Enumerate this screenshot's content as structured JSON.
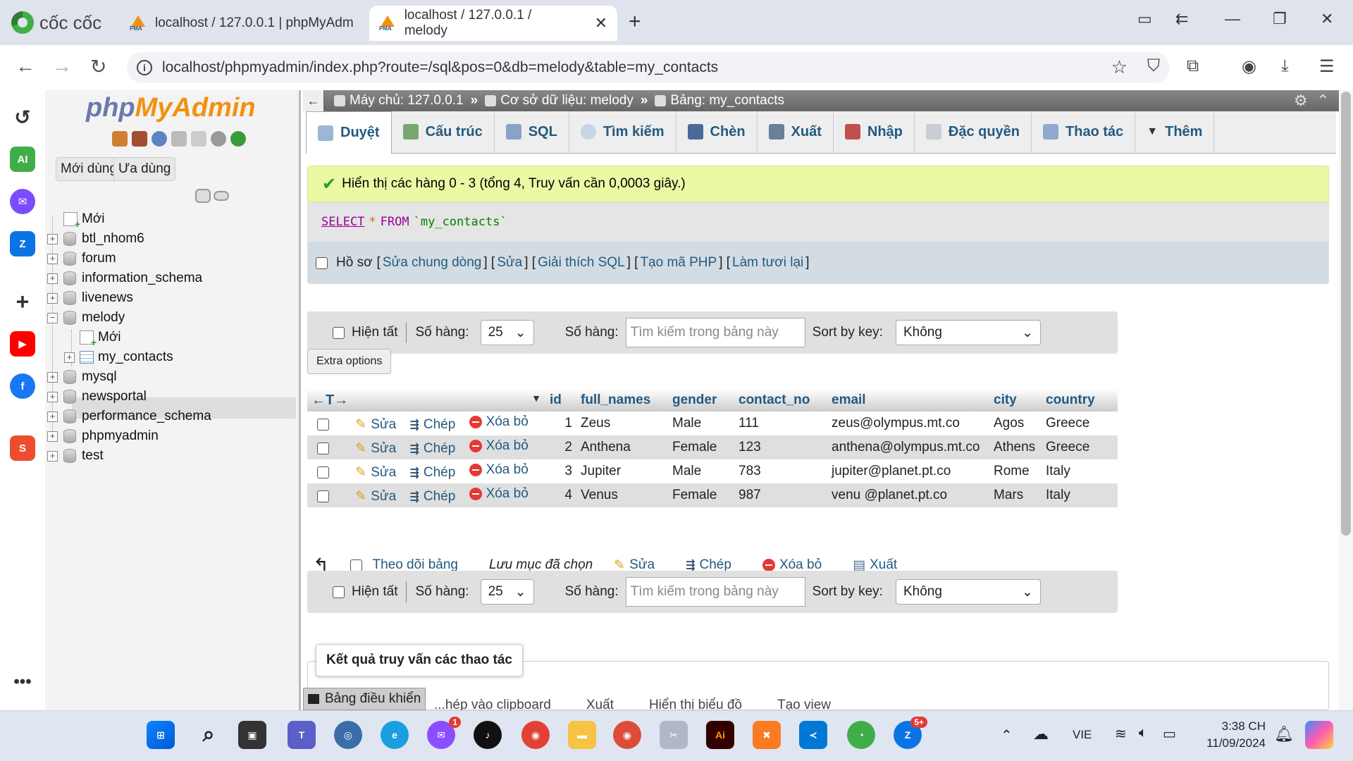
{
  "browser": {
    "brand": "cốc cốc",
    "tabs": [
      {
        "title": "localhost / 127.0.0.1 | phpMyAdm"
      },
      {
        "title": "localhost / 127.0.0.1 / melody"
      }
    ],
    "url": "localhost/phpmyadmin/index.php?route=/sql&pos=0&db=melody&table=my_contacts"
  },
  "sidebar": {
    "logo_php": "php",
    "logo_myadmin": "MyAdmin",
    "recent_btn": "Mới dùng",
    "favorite_btn": "Ưa dùng",
    "tree": [
      {
        "label": "Mới",
        "kind": "new",
        "level": 0
      },
      {
        "label": "btl_nhom6",
        "kind": "db",
        "level": 0
      },
      {
        "label": "forum",
        "kind": "db",
        "level": 0
      },
      {
        "label": "information_schema",
        "kind": "db",
        "level": 0
      },
      {
        "label": "livenews",
        "kind": "db",
        "level": 0
      },
      {
        "label": "melody",
        "kind": "db",
        "level": 0,
        "expanded": true
      },
      {
        "label": "Mới",
        "kind": "new",
        "level": 1
      },
      {
        "label": "my_contacts",
        "kind": "table",
        "level": 1,
        "selected": true
      },
      {
        "label": "mysql",
        "kind": "db",
        "level": 0
      },
      {
        "label": "newsportal",
        "kind": "db",
        "level": 0
      },
      {
        "label": "performance_schema",
        "kind": "db",
        "level": 0
      },
      {
        "label": "phpmyadmin",
        "kind": "db",
        "level": 0
      },
      {
        "label": "test",
        "kind": "db",
        "level": 0
      }
    ]
  },
  "breadcrumb": {
    "server": "Máy chủ: 127.0.0.1",
    "database": "Cơ sở dữ liệu: melody",
    "table": "Bảng: my_contacts",
    "sep": "»"
  },
  "tabs": [
    "Duyệt",
    "Cấu trúc",
    "SQL",
    "Tìm kiếm",
    "Chèn",
    "Xuất",
    "Nhập",
    "Đặc quyền",
    "Thao tác",
    "Thêm"
  ],
  "message": "Hiển thị các hàng 0 - 3 (tổng 4, Truy vấn cần 0,0003 giây.)",
  "sql": {
    "select": "SELECT",
    "star": "*",
    "from": "FROM",
    "table": "`my_contacts`",
    "profile_label": "Hồ sơ",
    "links": [
      "Sửa chung dòng",
      "Sửa",
      "Giải thích SQL",
      "Tạo mã PHP",
      "Làm tươi lại"
    ]
  },
  "nav": {
    "show_all": "Hiện tất",
    "rows_label": "Số hàng:",
    "rows_value": "25",
    "filter_label": "Số hàng:",
    "filter_placeholder": "Tìm kiếm trong bảng này",
    "sort_label": "Sort by key:",
    "sort_value": "Không"
  },
  "extra_options": "Extra options",
  "table": {
    "columns": [
      "id",
      "full_names",
      "gender",
      "contact_no",
      "email",
      "city",
      "country"
    ],
    "actions": {
      "edit": "Sửa",
      "copy": "Chép",
      "delete": "Xóa bỏ"
    },
    "rows": [
      [
        "1",
        "Zeus",
        "Male",
        "111",
        "zeus@olympus.mt.co",
        "Agos",
        "Greece"
      ],
      [
        "2",
        "Anthena",
        "Female",
        "123",
        "anthena@olympus.mt.co",
        "Athens",
        "Greece"
      ],
      [
        "3",
        "Jupiter",
        "Male",
        "783",
        "jupiter@planet.pt.co",
        "Rome",
        "Italy"
      ],
      [
        "4",
        "Venus",
        "Female",
        "987",
        "venu @planet.pt.co",
        "Mars",
        "Italy"
      ]
    ]
  },
  "bulk": {
    "track": "Theo dõi bảng",
    "with_selected": "Lưu mục đã chọn",
    "edit": "Sửa",
    "copy": "Chép",
    "delete": "Xóa bỏ",
    "export": "Xuất"
  },
  "ops": {
    "title": "Kết quả truy vấn các thao tác",
    "links": [
      "...hép vào clipboard",
      "Xuất",
      "Hiển thị biểu đồ",
      "Tạo view"
    ]
  },
  "console": "Bảng điều khiển",
  "taskbar": {
    "lang": "VIE",
    "time": "3:38 CH",
    "date": "11/09/2024",
    "messenger_badge": "1",
    "zalo_badge": "5+"
  }
}
